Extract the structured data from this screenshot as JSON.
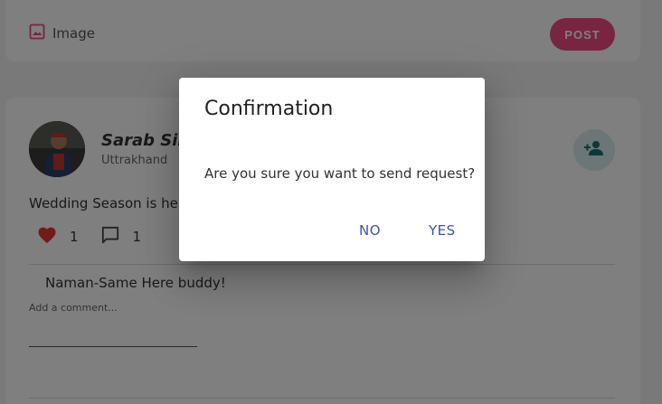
{
  "compose": {
    "image_label": "Image",
    "post_label": "POST"
  },
  "post": {
    "author": "Sarab Sing",
    "location": "Uttrakhand",
    "text": "Wedding Season is here",
    "likes": "1",
    "comments_count": "1",
    "comment": "Naman-Same Here buddy!",
    "comment_placeholder": "Add a comment..."
  },
  "dialog": {
    "title": "Confirmation",
    "message": "Are you sure you want to send request?",
    "no_label": "NO",
    "yes_label": "YES"
  },
  "colors": {
    "accent": "#ef4a82",
    "dialog_button": "#3f51b5",
    "like": "#e53935"
  },
  "icons": [
    "image-icon",
    "heart-icon",
    "comment-icon",
    "add-person-icon"
  ]
}
